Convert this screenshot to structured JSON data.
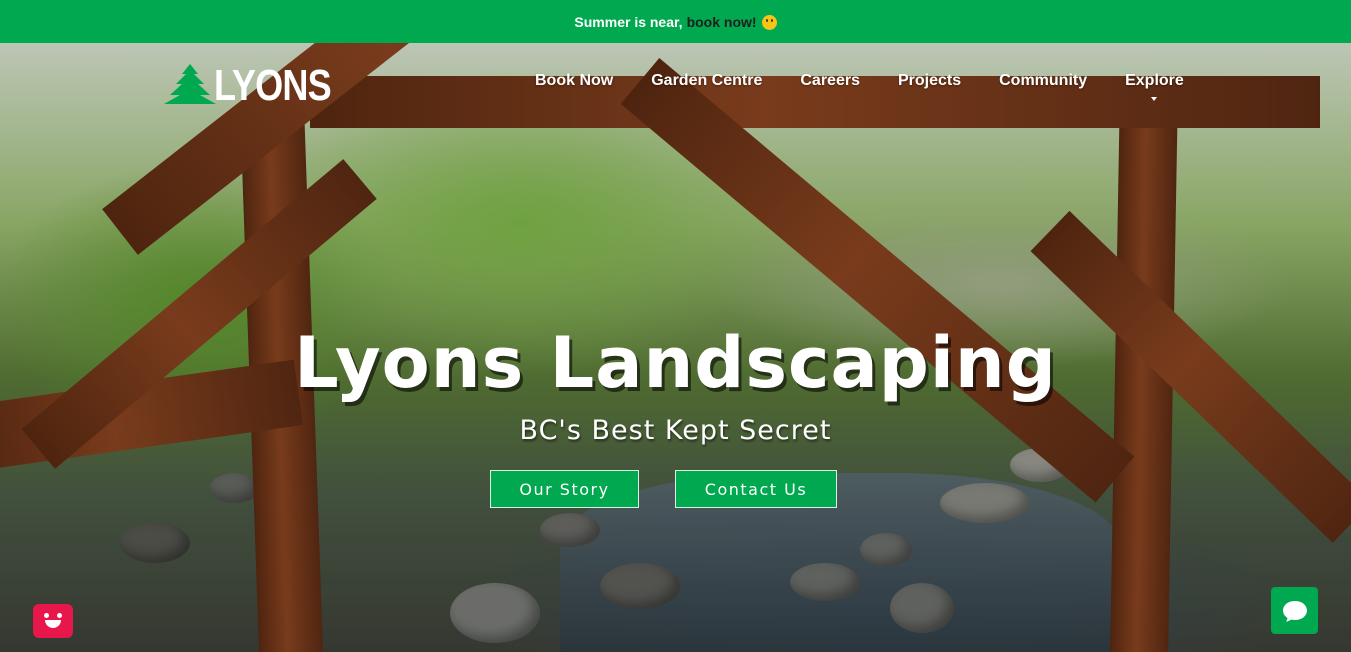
{
  "announcement": {
    "text": "Summer is near,",
    "link": "book now!",
    "emoji": "slightly-smiling-face"
  },
  "brand": {
    "name": "LYONS",
    "logo_icon": "pine-tree-icon",
    "accent": "#00a94f"
  },
  "nav": {
    "items": [
      "Book Now",
      "Garden Centre",
      "Careers",
      "Projects",
      "Community",
      "Explore"
    ]
  },
  "hero": {
    "title": "Lyons Landscaping",
    "subtitle": "BC's Best Kept Secret",
    "primary_button": "Our Story",
    "secondary_button": "Contact Us"
  },
  "widgets": {
    "left_icon": "smiley-chat-icon",
    "left_color": "#e8174b",
    "right_icon": "chat-bubble-icon",
    "right_color": "#00a94f"
  }
}
